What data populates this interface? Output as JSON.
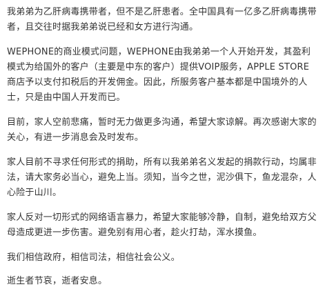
{
  "article": {
    "paragraphs": [
      "我弟弟为乙肝病毒携带者，但不是乙肝患者。全中国具有一亿多乙肝病毒携带者，且交往时据我弟弟说已经和女方进行沟通。",
      "WEPHONE的商业模式问题，WEPHONE由我弟弟一个人开始开发，其盈利模式为给国外的客户（主要是中东的客户）提供VOIP服务，APPLE STORE商店予以支付扣税后的开发佣金。因此，所服务客户基本都是中国境外的人士，只是由中国人开发而已。",
      "目前，家人空前悲痛，暂时无力做更多沟通，希望大家谅解。再次感谢大家的关心，有进一步消息会及时发布。",
      "家人目前不寻求任何形式的捐助，所有以我弟弟名义发起的捐款行动，均属非法，请大家务必当心，避免上当。须知，当今之世，泥沙俱下，鱼龙混杂，人心险于山川。",
      "家人反对一切形式的网络语言暴力，希望大家能够冷静，自制，避免给双方父母造成更进一步伤害。避免别有用心者，趁火打劫，浑水摸鱼。",
      "我们相信政府，相信司法，相信社会公义。",
      "逝生者节哀，逝者安息。"
    ]
  }
}
